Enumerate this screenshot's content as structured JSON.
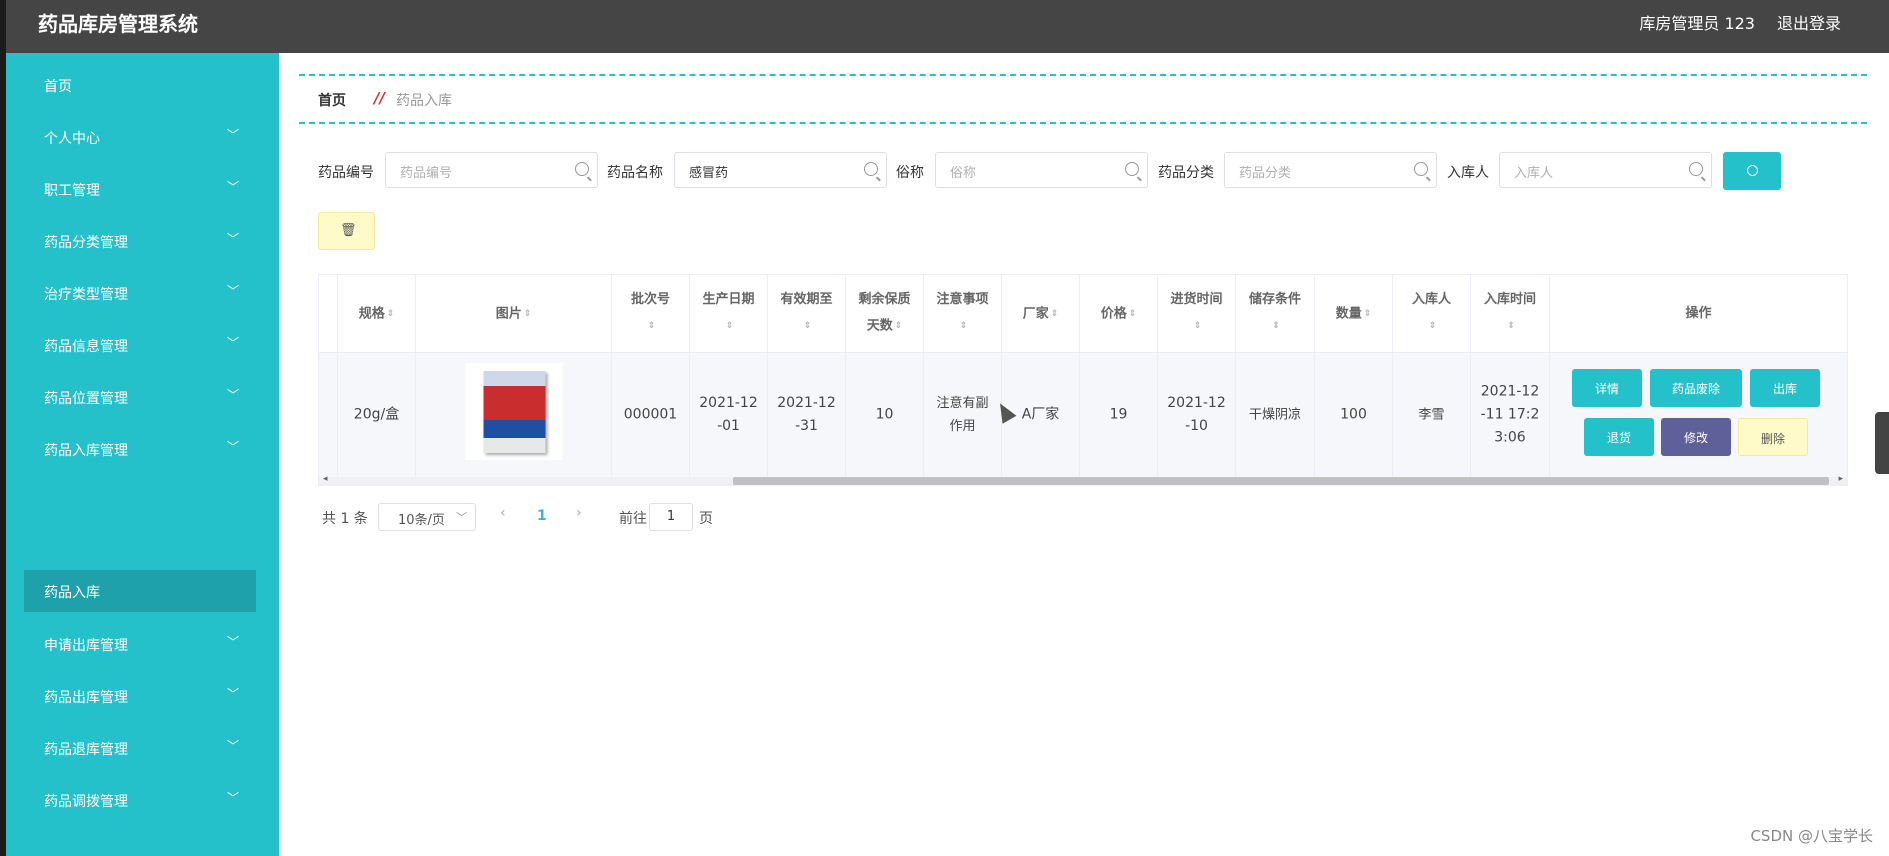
{
  "app": {
    "title": "药品库房管理系统",
    "user": "库房管理员 123",
    "logout": "退出登录"
  },
  "sidebar": {
    "items": [
      {
        "label": "首页",
        "expandable": false
      },
      {
        "label": "个人中心",
        "expandable": true
      },
      {
        "label": "职工管理",
        "expandable": true
      },
      {
        "label": "药品分类管理",
        "expandable": true
      },
      {
        "label": "治疗类型管理",
        "expandable": true
      },
      {
        "label": "药品信息管理",
        "expandable": true
      },
      {
        "label": "药品位置管理",
        "expandable": true
      },
      {
        "label": "药品入库管理",
        "expandable": true
      },
      {
        "label": "申请出库管理",
        "expandable": true
      },
      {
        "label": "药品出库管理",
        "expandable": true
      },
      {
        "label": "药品退库管理",
        "expandable": true
      },
      {
        "label": "药品调拨管理",
        "expandable": true
      }
    ],
    "active_sub": "药品入库",
    "chevron": "chevron-down-icon"
  },
  "breadcrumb": {
    "home": "首页",
    "separator": "//",
    "current": "药品入库"
  },
  "search": {
    "fields": [
      {
        "label": "药品编号",
        "placeholder": "药品编号",
        "value": ""
      },
      {
        "label": "药品名称",
        "placeholder": "药品名称",
        "value": "感冒药"
      },
      {
        "label": "俗称",
        "placeholder": "俗称",
        "value": ""
      },
      {
        "label": "药品分类",
        "placeholder": "药品分类",
        "value": ""
      },
      {
        "label": "入库人",
        "placeholder": "入库人",
        "value": ""
      }
    ],
    "button_icon": "search-icon"
  },
  "toolbar": {
    "batch_delete_icon": "trash-icon",
    "batch_delete_glyph": "🗑"
  },
  "table": {
    "headers": {
      "spec": "规格",
      "image": "图片",
      "batch": "批次号",
      "prod_date": "生产日期",
      "expiry": "有效期至",
      "remain_a": "剩余保质",
      "remain_b": "天数",
      "notes": "注意事项",
      "maker": "厂家",
      "price": "价格",
      "purchase_time": "进货时间",
      "storage": "储存条件",
      "qty": "数量",
      "receiver": "入库人",
      "in_time": "入库时间",
      "ops": "操作"
    },
    "rows": [
      {
        "spec": "20g/盒",
        "image": "medicine-box-image",
        "batch": "000001",
        "prod_date_a": "2021-12",
        "prod_date_b": "-01",
        "expiry_a": "2021-12",
        "expiry_b": "-31",
        "remain": "10",
        "notes_a": "注意有副",
        "notes_b": "作用",
        "maker": "A厂家",
        "price": "19",
        "purchase_a": "2021-12",
        "purchase_b": "-10",
        "storage": "干燥阴凉",
        "qty": "100",
        "receiver": "李雪",
        "in_time_a": "2021-12",
        "in_time_b": "-11 17:2",
        "in_time_c": "3:06"
      }
    ],
    "actions": {
      "detail": "详情",
      "scrap": "药品废除",
      "out": "出库",
      "return": "退货",
      "edit": "修改",
      "delete": "删除"
    }
  },
  "pagination": {
    "total": "共 1 条",
    "page_size": "10条/页",
    "current_page": "1",
    "goto_prefix": "前往",
    "goto_value": "1",
    "goto_suffix": "页"
  },
  "colors": {
    "accent": "#25c1cb",
    "header_bg": "#454545",
    "edit": "#5f5f9a",
    "warn_bg": "#fefbc9"
  },
  "watermark": "CSDN @八宝学长"
}
